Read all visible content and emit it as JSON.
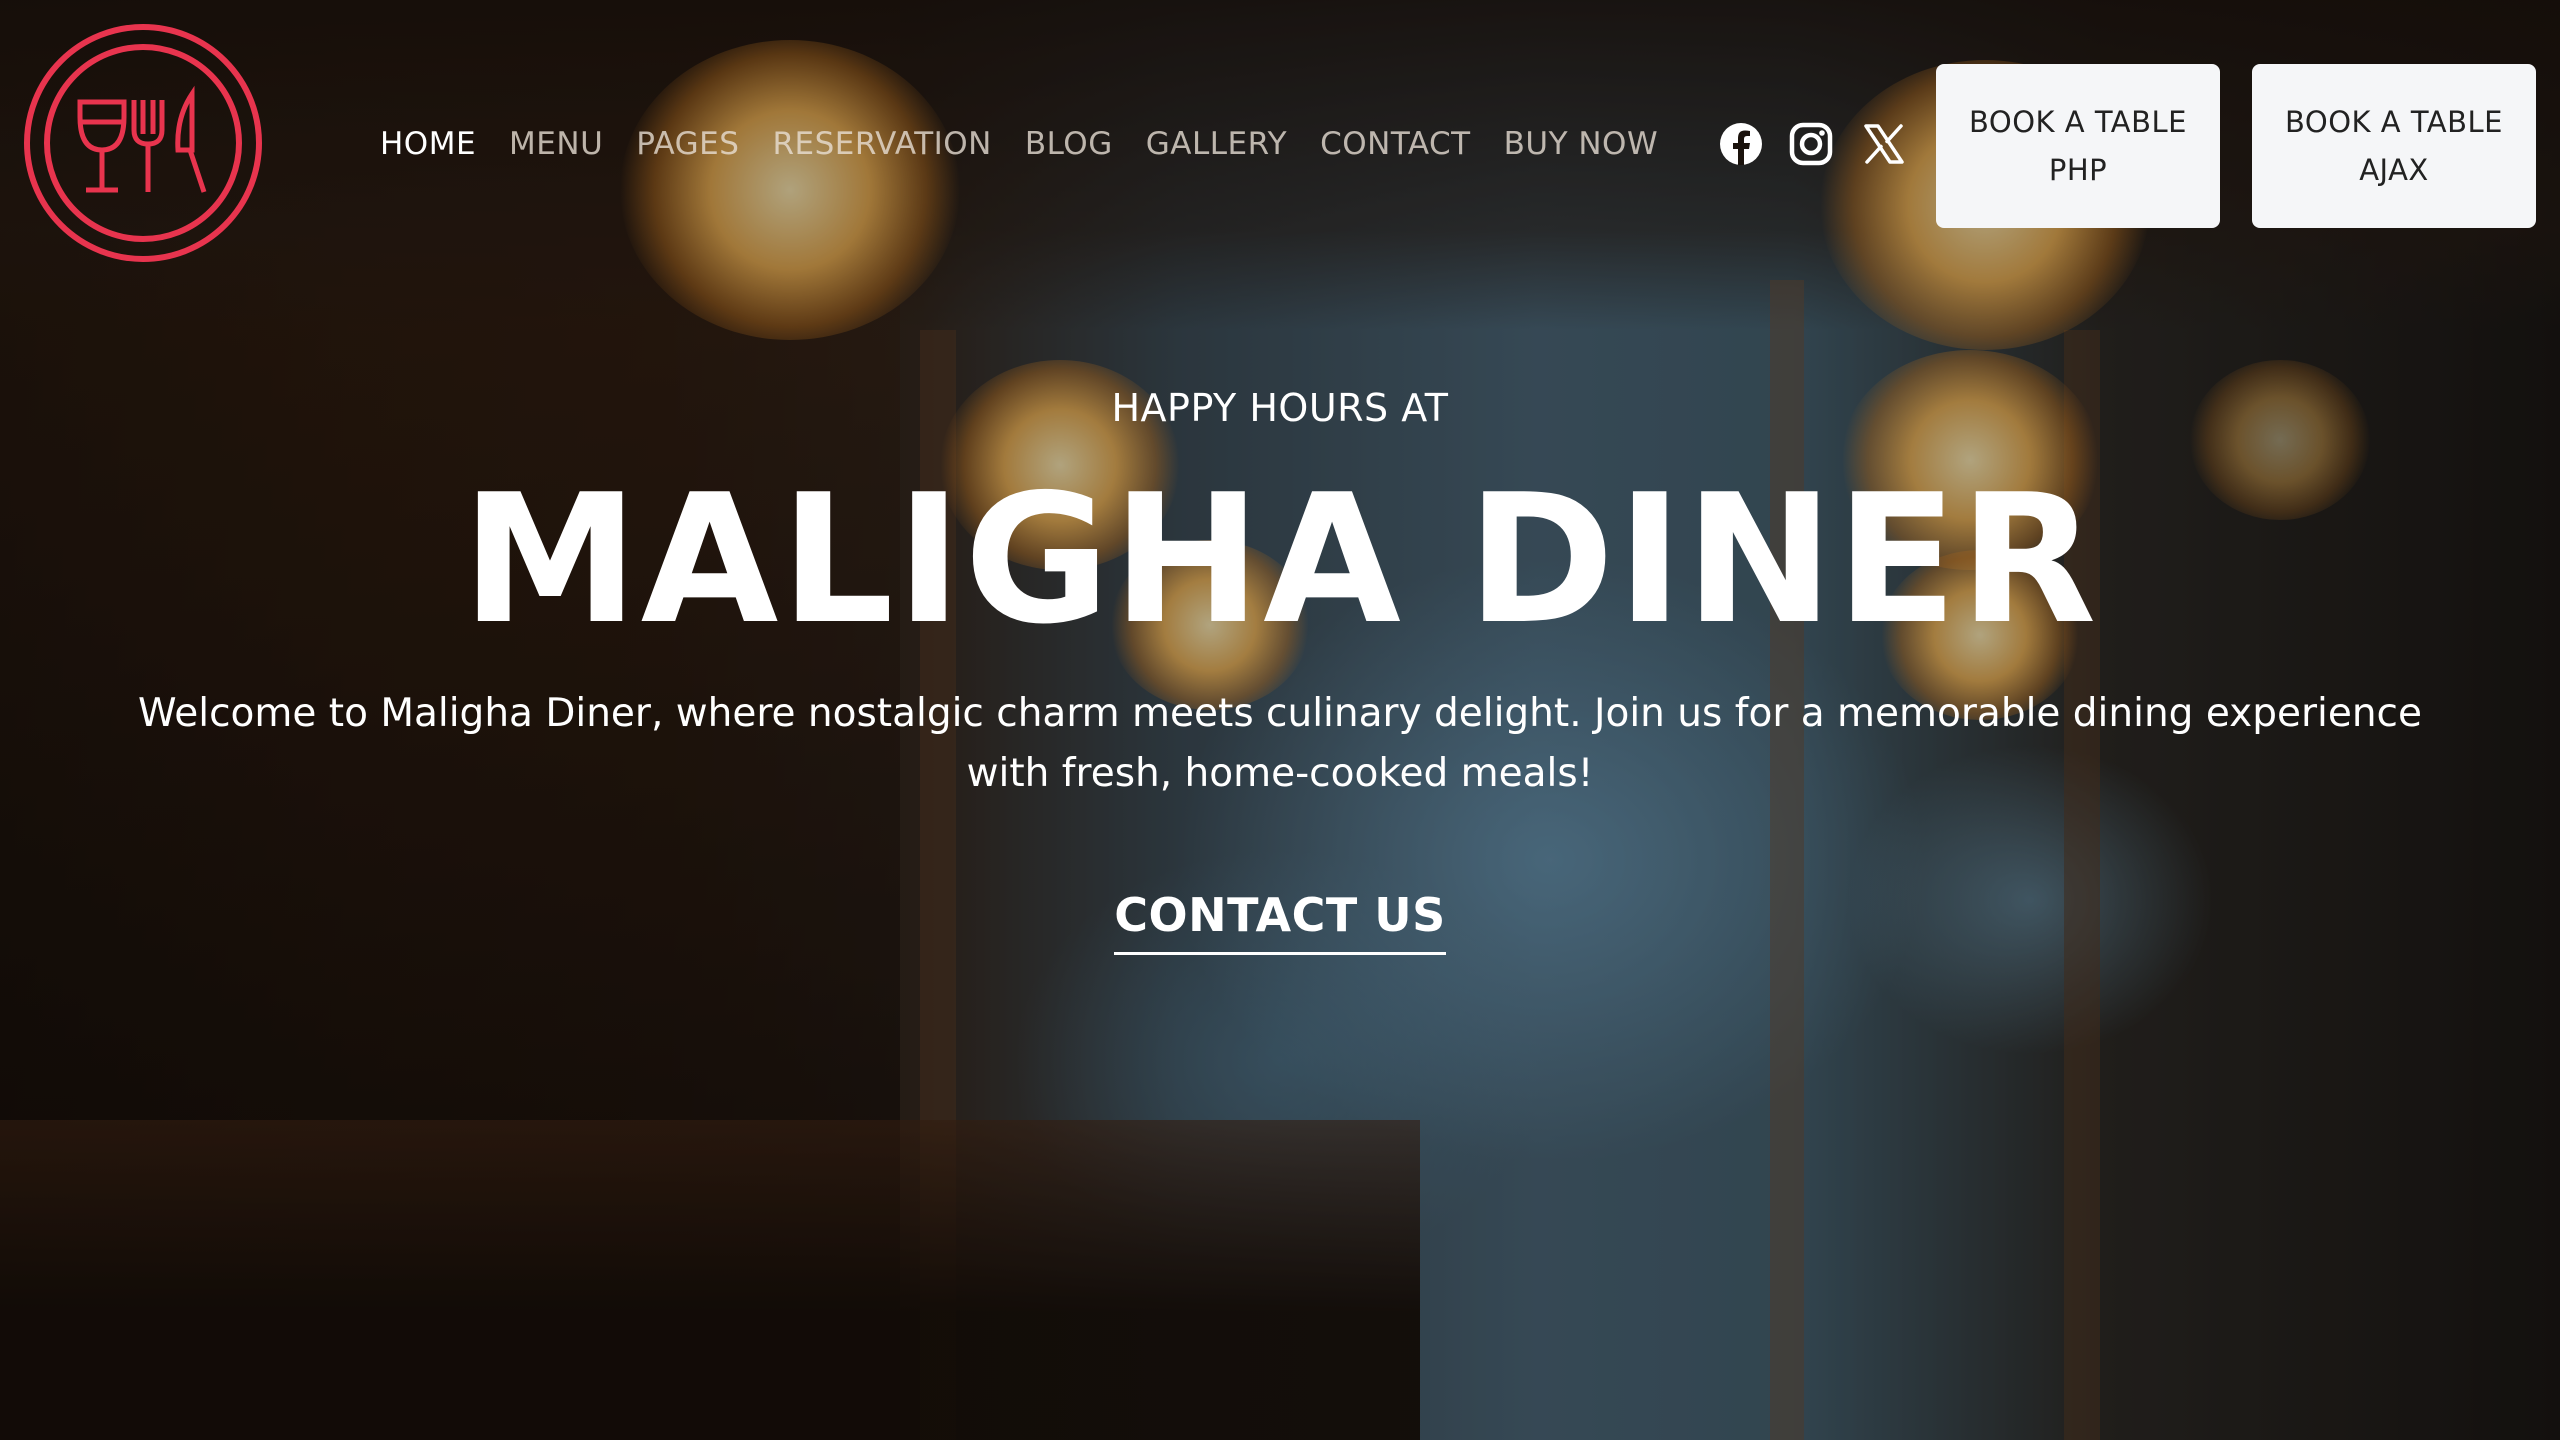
{
  "brand": {
    "logo_icon": "wine-glass-fork-knife-icon",
    "accent_color": "#e8344e"
  },
  "nav": {
    "items": [
      {
        "label": "HOME",
        "active": true
      },
      {
        "label": "MENU"
      },
      {
        "label": "PAGES"
      },
      {
        "label": "RESERVATION"
      },
      {
        "label": "BLOG"
      },
      {
        "label": "GALLERY"
      },
      {
        "label": "CONTACT"
      },
      {
        "label": "BUY NOW"
      }
    ]
  },
  "social": {
    "icons": [
      "facebook-icon",
      "instagram-icon",
      "x-icon"
    ]
  },
  "buttons": {
    "book_php": {
      "line1": "BOOK A TABLE",
      "line2": "PHP"
    },
    "book_ajax": {
      "line1": "BOOK A TABLE",
      "line2": "AJAX"
    }
  },
  "hero": {
    "kicker": "HAPPY HOURS AT",
    "title": "MALIGHA DINER",
    "lead_line1": "Welcome to Maligha Diner, where nostalgic charm meets culinary delight. Join us for a memorable dining experience",
    "lead_line2": "with fresh, home-cooked meals!",
    "cta": "CONTACT US"
  }
}
